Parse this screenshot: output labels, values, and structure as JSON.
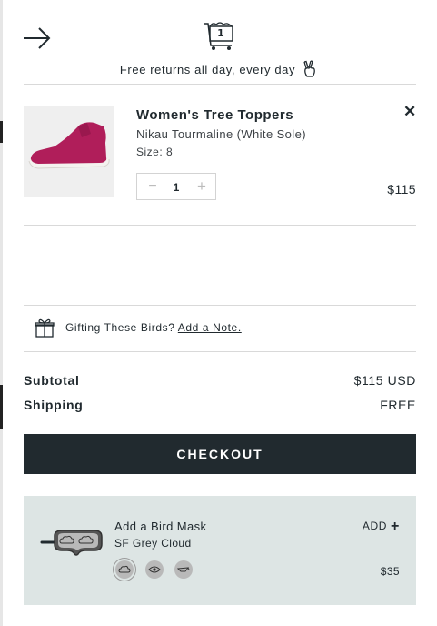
{
  "header": {
    "cart_count": "1",
    "returns_text": "Free returns all day, every day"
  },
  "item": {
    "name": "Women's Tree Toppers",
    "variant": "Nikau Tourmaline (White Sole)",
    "size": "Size: 8",
    "quantity": "1",
    "price": "$115",
    "colors": {
      "shoe": "#b01e5a",
      "sole": "#f4f2ef"
    }
  },
  "gift": {
    "text": "Gifting These Birds?",
    "link": "Add a Note."
  },
  "summary": {
    "subtotal_label": "Subtotal",
    "subtotal_value": "$115 USD",
    "shipping_label": "Shipping",
    "shipping_value": "FREE"
  },
  "checkout": {
    "label": "CHECKOUT"
  },
  "upsell": {
    "title": "Add a Bird Mask",
    "variant": "SF Grey Cloud",
    "add_label": "ADD",
    "price": "$35",
    "swatches": [
      "cloud",
      "eye",
      "bird"
    ],
    "selected_swatch": "cloud",
    "background": "#dde5e4"
  },
  "colors": {
    "accent": "#212a2f",
    "divider": "#d9d9d9"
  }
}
